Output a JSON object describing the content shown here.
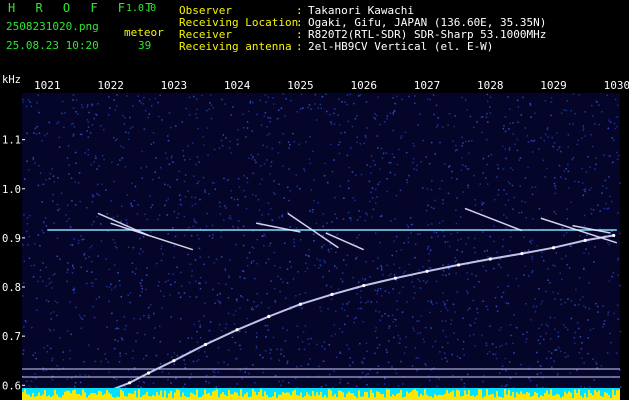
{
  "header": {
    "app_name": "H R O F F T",
    "version": "1.0.0",
    "filename": "2508231020.png",
    "datetime": "25.08.23 10:20",
    "counter_label": "meteor",
    "counter_value": "39",
    "fields": [
      {
        "label": "Observer",
        "sep": ":",
        "value": "Takanori Kawachi"
      },
      {
        "label": "Receiving Location",
        "sep": ":",
        "value": "Ogaki, Gifu, JAPAN (136.60E, 35.35N)"
      },
      {
        "label": "Receiver",
        "sep": ":",
        "value": "R820T2(RTL-SDR) SDR-Sharp 53.1000MHz"
      },
      {
        "label": "Receiving antenna",
        "sep": ":",
        "value": "2el-HB9CV Vertical (el. E-W)"
      }
    ]
  },
  "colors": {
    "background": "#000000",
    "plot_background": "#05052a",
    "header_label": "#f6f600",
    "app_name": "#2ee82e",
    "trace": "#d8d8ff",
    "carrier": "#7fe0ff",
    "baseline_cyan": "#00e0ff",
    "baseline_yellow": "#ffe600"
  },
  "chart_data": {
    "type": "scatter",
    "title": "",
    "xlabel": "",
    "ylabel": "kHz",
    "x_ticks": [
      "1021",
      "1022",
      "1023",
      "1024",
      "1025",
      "1026",
      "1027",
      "1028",
      "1029",
      "1030"
    ],
    "y_ticks": [
      "1.1",
      "1.0",
      "0.9",
      "0.8",
      "0.7",
      "0.6"
    ],
    "xlim": [
      1020.6,
      1030.05
    ],
    "ylim": [
      0.57,
      1.195
    ],
    "grid": false,
    "series": [
      {
        "role": "continuous-carrier",
        "x": [
          1021.0,
          1030.0
        ],
        "y": [
          0.916,
          0.916
        ]
      },
      {
        "role": "drifting-signal",
        "x": [
          1021.7,
          1022.0,
          1022.3,
          1022.6,
          1023.0,
          1023.5,
          1024.0,
          1024.5,
          1025.0,
          1025.5,
          1026.0,
          1026.5,
          1027.0,
          1027.5,
          1028.0,
          1028.5,
          1029.0,
          1029.5,
          1029.95
        ],
        "y": [
          0.575,
          0.59,
          0.605,
          0.625,
          0.65,
          0.683,
          0.713,
          0.74,
          0.765,
          0.785,
          0.803,
          0.818,
          0.832,
          0.845,
          0.857,
          0.868,
          0.88,
          0.895,
          0.905
        ]
      },
      {
        "role": "meteor-streaks",
        "segments": [
          {
            "x": [
              1021.8,
              1022.6
            ],
            "y": [
              0.95,
              0.905
            ]
          },
          {
            "x": [
              1022.0,
              1023.3
            ],
            "y": [
              0.93,
              0.876
            ]
          },
          {
            "x": [
              1024.3,
              1025.0
            ],
            "y": [
              0.93,
              0.912
            ]
          },
          {
            "x": [
              1024.8,
              1025.6
            ],
            "y": [
              0.95,
              0.88
            ]
          },
          {
            "x": [
              1025.4,
              1026.0
            ],
            "y": [
              0.91,
              0.876
            ]
          },
          {
            "x": [
              1027.6,
              1028.5
            ],
            "y": [
              0.96,
              0.915
            ]
          },
          {
            "x": [
              1028.8,
              1030.0
            ],
            "y": [
              0.94,
              0.89
            ]
          },
          {
            "x": [
              1029.3,
              1029.9
            ],
            "y": [
              0.925,
              0.91
            ]
          }
        ]
      }
    ]
  }
}
